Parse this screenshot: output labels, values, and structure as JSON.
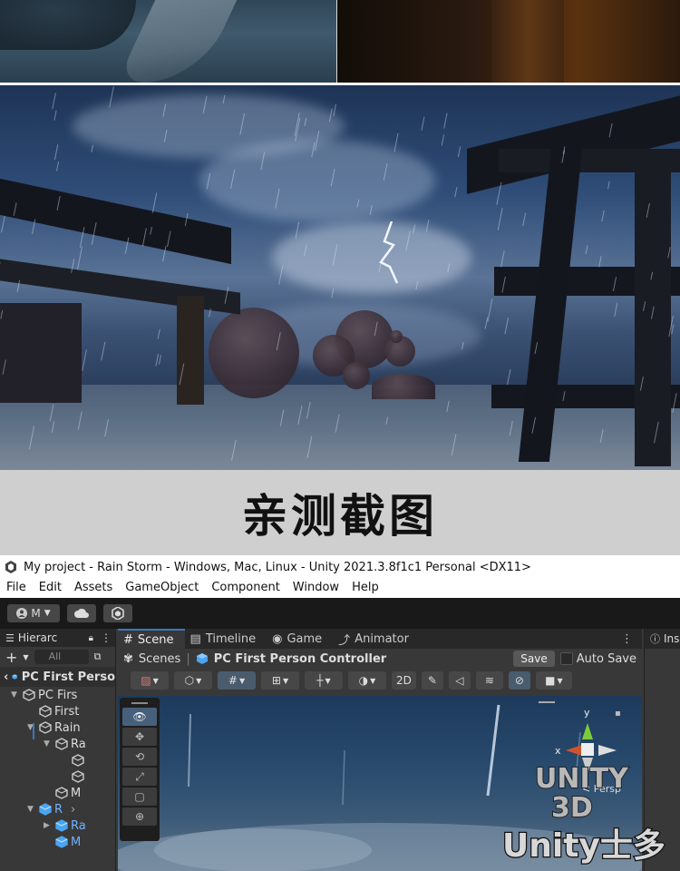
{
  "caption": {
    "text": "亲测截图"
  },
  "editor": {
    "window_title": "My project - Rain Storm - Windows, Mac, Linux - Unity 2021.3.8f1c1 Personal <DX11>",
    "menu": [
      "File",
      "Edit",
      "Assets",
      "GameObject",
      "Component",
      "Window",
      "Help"
    ],
    "toolbar": {
      "account_label": "M"
    },
    "hierarchy": {
      "tab_label": "Hierarc",
      "search_placeholder": "All",
      "breadcrumb": "PC First Perso",
      "rows": [
        {
          "label": "PC Firs",
          "indent": 1,
          "arrow": "▼",
          "blue": false
        },
        {
          "label": "First",
          "indent": 2,
          "arrow": "",
          "blue": false
        },
        {
          "label": "Rain",
          "indent": 2,
          "arrow": "▼",
          "blue": false
        },
        {
          "label": "Ra",
          "indent": 3,
          "arrow": "▼",
          "blue": false
        },
        {
          "label": "",
          "indent": 4,
          "arrow": "",
          "blue": false
        },
        {
          "label": "",
          "indent": 4,
          "arrow": "",
          "blue": false
        },
        {
          "label": "M",
          "indent": 3,
          "arrow": "",
          "blue": false
        },
        {
          "label": "R",
          "indent": 2,
          "arrow": "▼",
          "blue": true
        },
        {
          "label": "Ra",
          "indent": 3,
          "arrow": "▶",
          "blue": true
        },
        {
          "label": "M",
          "indent": 3,
          "arrow": "",
          "blue": true
        }
      ]
    },
    "scene_tabs": [
      "Scene",
      "Timeline",
      "Game",
      "Animator"
    ],
    "scene_breadcrumb": {
      "root": "Scenes",
      "current": "PC First Person Controller"
    },
    "save_label": "Save",
    "auto_save_label": "Auto Save",
    "tool_2d_label": "2D",
    "gizmo": {
      "y_label": "y",
      "x_label": "x",
      "persp_label": "< Persp"
    },
    "inspector_tab_label": "Ins"
  },
  "watermark": {
    "line1": "UNITY",
    "line2": "3D",
    "line3": "Unity士多"
  }
}
